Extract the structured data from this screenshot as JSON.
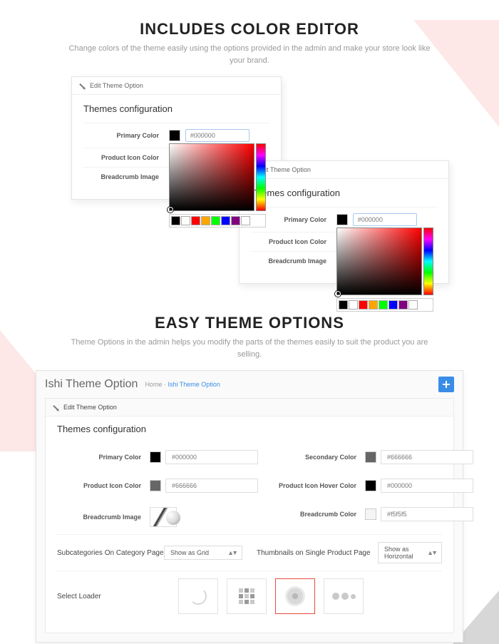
{
  "section1": {
    "title": "INCLUDES COLOR EDITOR",
    "subtitle": "Change colors of the theme easily using the options provided in the admin and make your store look like your brand."
  },
  "panel": {
    "header": "Edit Theme Option",
    "config_title": "Themes configuration",
    "labels": {
      "primary": "Primary Color",
      "product_icon": "Product Icon Color",
      "breadcrumb_image": "Breadcrumb Image"
    },
    "primary_value": "#000000"
  },
  "swatches": [
    "#000000",
    "#ffffff",
    "#ff0000",
    "#ffa500",
    "#00ff00",
    "#0000ff",
    "#800080",
    "#ffffff"
  ],
  "section2": {
    "title": "EASY THEME OPTIONS",
    "subtitle": "Theme Options in the admin helps you modify the parts of the themes easily to suit the product you are selling."
  },
  "big": {
    "title": "Ishi Theme Option",
    "crumb_home": "Home",
    "crumb_current": "Ishi Theme Option",
    "header": "Edit Theme Option",
    "config_title": "Themes configuration",
    "fields": {
      "primary_color": {
        "label": "Primary Color",
        "value": "#000000",
        "swatch": "#000000"
      },
      "secondary_color": {
        "label": "Secondary Color",
        "value": "#666666",
        "swatch": "#666666"
      },
      "product_icon_color": {
        "label": "Product Icon Color",
        "value": "#666666",
        "swatch": "#666666"
      },
      "product_icon_hover_color": {
        "label": "Product Icon Hover Color",
        "value": "#000000",
        "swatch": "#000000"
      },
      "breadcrumb_image": {
        "label": "Breadcrumb Image"
      },
      "breadcrumb_color": {
        "label": "Breadcrumb Color",
        "value": "#f5f5f5",
        "swatch": "#f5f5f5"
      },
      "subcategories": {
        "label": "Subcategories On Category Page",
        "value": "Show as Grid"
      },
      "thumbnails": {
        "label": "Thumbnails on Single Product Page",
        "value": "Show as Horizontal"
      },
      "select_loader": {
        "label": "Select Loader"
      }
    }
  }
}
